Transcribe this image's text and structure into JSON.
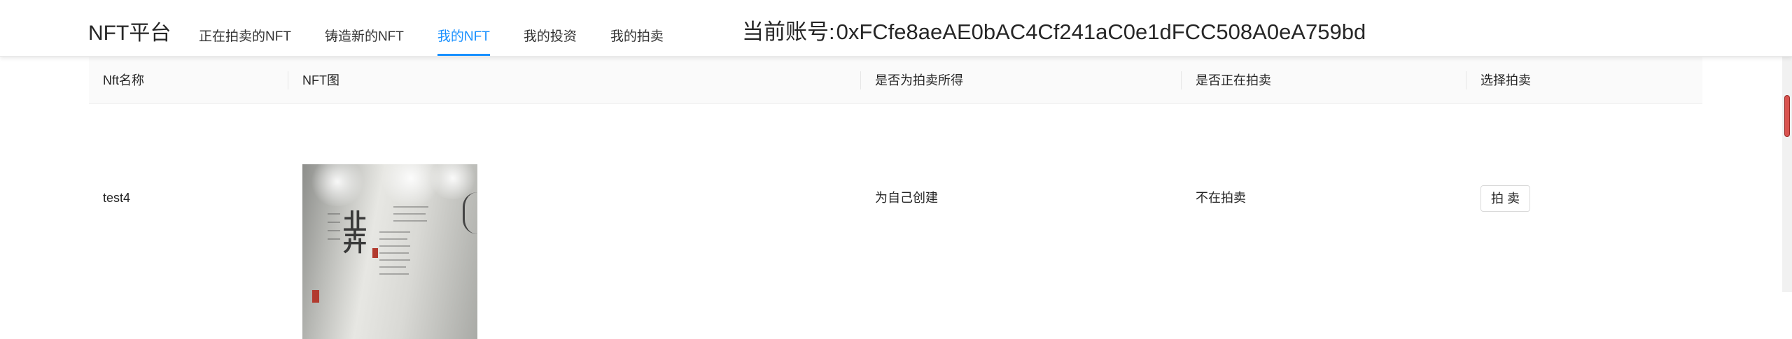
{
  "header": {
    "logo": "NFT平台",
    "nav": [
      {
        "label": "正在拍卖的NFT",
        "active": false
      },
      {
        "label": "铸造新的NFT",
        "active": false
      },
      {
        "label": "我的NFT",
        "active": true
      },
      {
        "label": "我的投资",
        "active": false
      },
      {
        "label": "我的拍卖",
        "active": false
      }
    ],
    "account_label": "当前账号:",
    "account_address": "0xFCfe8aeAE0bAC4Cf241aC0e1dFCC508A0eA759bd"
  },
  "table": {
    "columns": [
      "Nft名称",
      "NFT图",
      "是否为拍卖所得",
      "是否正在拍卖",
      "选择拍卖"
    ],
    "rows": [
      {
        "name": "test4",
        "image": "gallery-wall-photo",
        "from_auction": "为自己创建",
        "on_auction": "不在拍卖",
        "action_label": "拍 卖"
      }
    ]
  },
  "colors": {
    "accent": "#1890ff",
    "text": "#262626",
    "table_header_bg": "#fafafa",
    "scroll_thumb": "#d9534f"
  }
}
